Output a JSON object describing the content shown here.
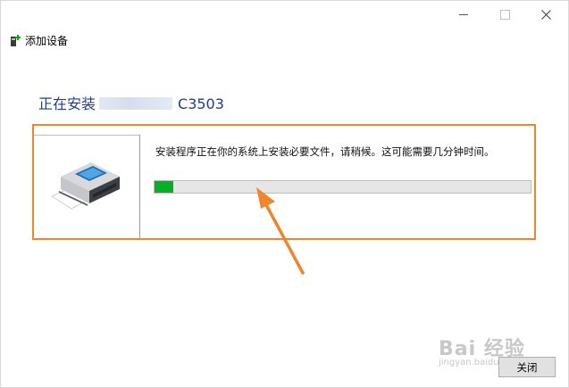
{
  "window": {
    "title": "添加设备",
    "controls": {
      "minimize_icon": "minimize-icon",
      "maximize_icon": "maximize-icon",
      "close_icon": "close-icon"
    }
  },
  "main": {
    "heading_prefix": "正在安装",
    "heading_suffix": "C3503",
    "status_text": "安装程序正在你的系统上安装必要文件，请稍候。这可能需要几分钟时间。",
    "progress_fraction": 0.05
  },
  "annotation": {
    "highlight_color": "#f0852c",
    "arrow_color": "#f0852c"
  },
  "colors": {
    "heading": "#1e3e8a",
    "progress": "#06b025"
  },
  "watermark": {
    "main": "Bai 经验",
    "sub": "jingyan.baidu.com"
  },
  "footer": {
    "close_label": "关闭"
  }
}
